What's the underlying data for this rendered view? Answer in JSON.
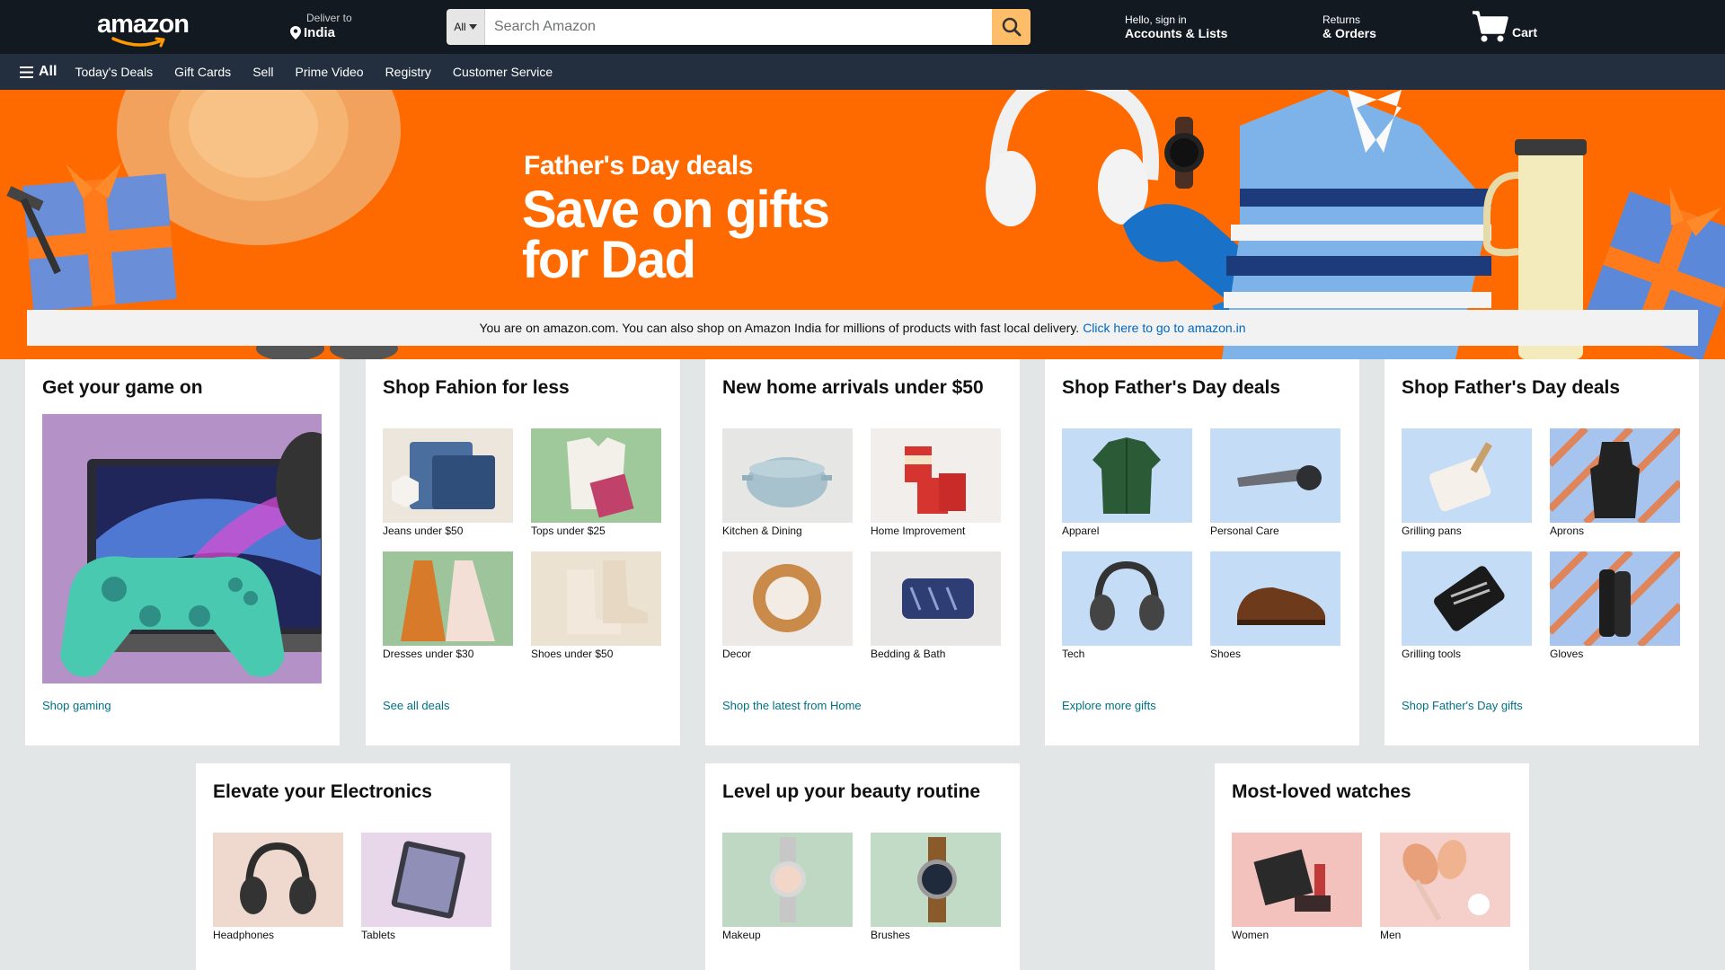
{
  "header": {
    "logo_text": "amazon",
    "deliver_label": "Deliver to",
    "deliver_location": "India",
    "search_category": "All",
    "search_placeholder": "Search Amazon",
    "account_greeting": "Hello, sign in",
    "account_label": "Accounts & Lists",
    "returns_label": "Returns",
    "orders_label": "& Orders",
    "cart_label": "Cart"
  },
  "subnav": {
    "all_label": "All",
    "items": [
      "Today's Deals",
      "Gift Cards",
      "Sell",
      "Prime Video",
      "Registry",
      "Customer Service"
    ]
  },
  "hero": {
    "subtitle": "Father's Day deals",
    "title": "Save on gifts for Dad"
  },
  "notice": {
    "text": "You are on amazon.com. You can also shop on Amazon India for millions of products with fast local delivery.",
    "link": "Click here to go to amazon.in"
  },
  "cards": [
    {
      "title": "Get your game on",
      "link": "Shop gaming"
    },
    {
      "title": "Shop Fahion for less",
      "link": "See all deals",
      "tiles": [
        "Jeans under $50",
        "Tops under $25",
        "Dresses under $30",
        "Shoes under $50"
      ]
    },
    {
      "title": "New home arrivals under $50",
      "link": "Shop the latest from Home",
      "tiles": [
        "Kitchen & Dining",
        "Home Improvement",
        "Decor",
        "Bedding & Bath"
      ]
    },
    {
      "title": "Shop Father's Day deals",
      "link": "Explore more gifts",
      "tiles": [
        "Apparel",
        "Personal Care",
        "Tech",
        "Shoes"
      ]
    },
    {
      "title": "Shop Father's Day deals",
      "link": "Shop Father's Day gifts",
      "tiles": [
        "Grilling pans",
        "Aprons",
        "Grilling tools",
        "Gloves"
      ]
    },
    {
      "title": "Elevate your Electronics",
      "tiles": [
        "Headphones",
        "Tablets"
      ]
    },
    {
      "title": "Level up your beauty routine",
      "tiles": [
        "Makeup",
        "Brushes"
      ]
    },
    {
      "title": "Most-loved watches",
      "tiles": [
        "Women",
        "Men"
      ]
    }
  ],
  "colors": {
    "header_bg": "#131921",
    "subnav_bg": "#232f3e",
    "hero_bg": "#ff6a00",
    "search_button": "#febd69",
    "link": "#007185"
  }
}
